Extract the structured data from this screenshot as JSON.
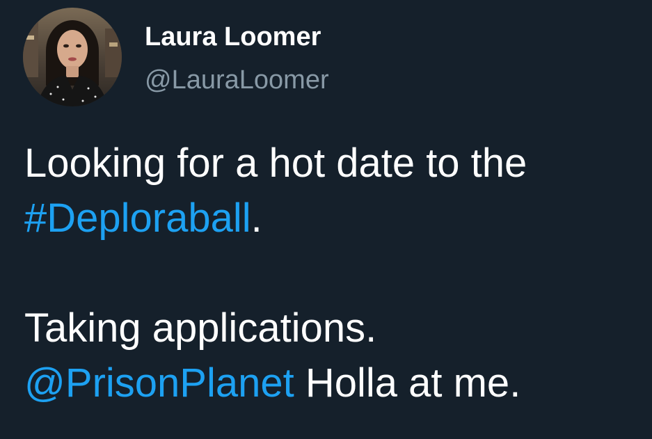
{
  "author": {
    "display_name": "Laura Loomer",
    "handle": "@LauraLoomer"
  },
  "tweet": {
    "line1": "Looking for a hot date to the",
    "hashtag": "#Deploraball",
    "hashtag_suffix": ".",
    "line3": "Taking applications.",
    "mention": "@PrisonPlanet",
    "mention_suffix": " Holla at me."
  },
  "colors": {
    "background": "#15202b",
    "text": "#ffffff",
    "secondary_text": "#8899a6",
    "link": "#1da1f2"
  }
}
